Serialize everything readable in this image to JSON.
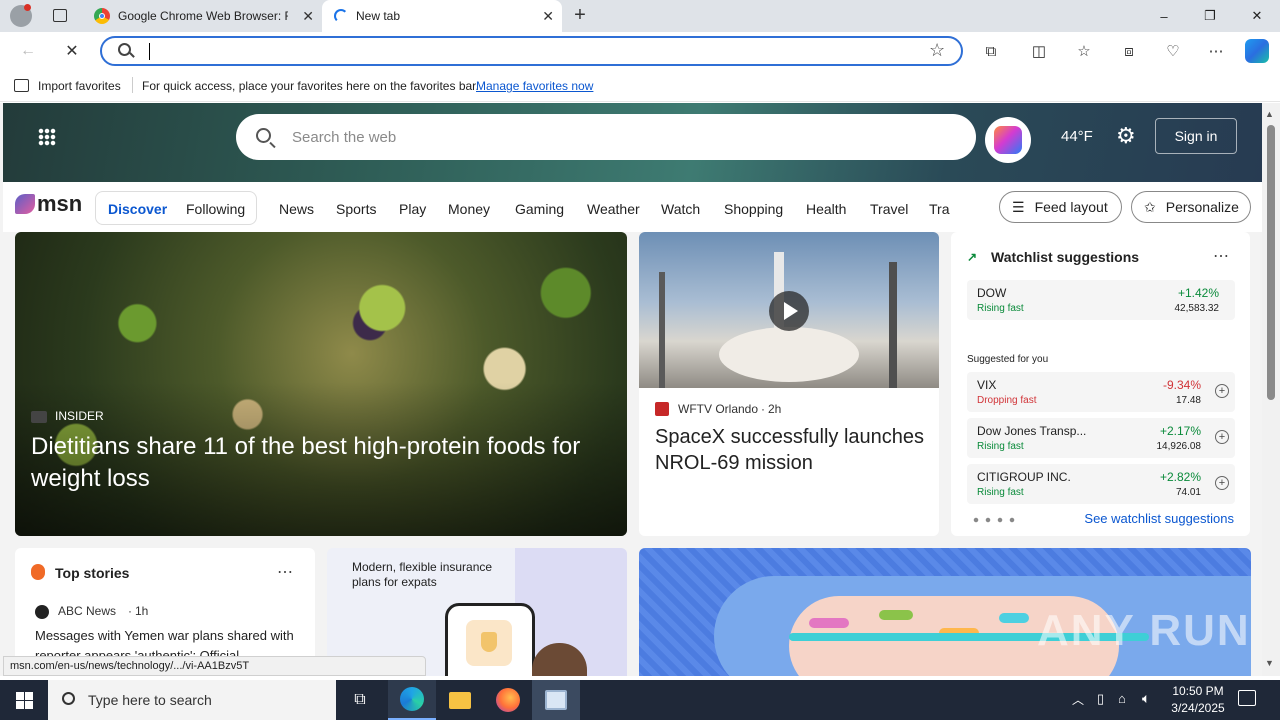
{
  "tabs": [
    {
      "title": "Google Chrome Web Browser: Fi",
      "active": false
    },
    {
      "title": "New tab",
      "active": true
    }
  ],
  "window": {
    "minimize": "–",
    "restore": "❐",
    "close": "✕"
  },
  "favorites_bar": {
    "import_label": "Import favorites",
    "hint_text": "For quick access, place your favorites here on the favorites bar.",
    "manage_link": "Manage favorites now"
  },
  "msn": {
    "search_placeholder": "Search the web",
    "temperature": "44°F",
    "sign_in": "Sign in",
    "logo": "msn",
    "tabs": [
      "Discover",
      "Following"
    ],
    "nav": [
      "News",
      "Sports",
      "Play",
      "Money",
      "Gaming",
      "Weather",
      "Watch",
      "Shopping",
      "Health",
      "Travel",
      "Tra"
    ],
    "feed_layout": "Feed layout",
    "personalize": "Personalize"
  },
  "hero_story": {
    "source": "INSIDER",
    "headline": "Dietitians share 11 of the best high-protein foods for weight loss"
  },
  "video_story": {
    "source": "WFTV Orlando",
    "age": "2h",
    "headline": "SpaceX successfully launches NROL-69 mission"
  },
  "watchlist": {
    "title": "Watchlist suggestions",
    "suggested_label": "Suggested for you",
    "see_more": "See watchlist suggestions",
    "items": [
      {
        "name": "DOW",
        "status": "Rising fast",
        "change": "+1.42%",
        "value": "42,583.32",
        "direction": "up"
      },
      {
        "name": "VIX",
        "status": "Dropping fast",
        "change": "-9.34%",
        "value": "17.48",
        "direction": "down"
      },
      {
        "name": "Dow Jones Transp...",
        "status": "Rising fast",
        "change": "+2.17%",
        "value": "14,926.08",
        "direction": "up"
      },
      {
        "name": "CITIGROUP INC.",
        "status": "Rising fast",
        "change": "+2.82%",
        "value": "74.01",
        "direction": "up"
      }
    ],
    "colors": {
      "up": "#0a8a3a",
      "down": "#d13438"
    }
  },
  "top_stories": {
    "title": "Top stories",
    "source": "ABC News",
    "age": "1h",
    "headline": "Messages with Yemen war plans shared with reporter appears 'authentic': Official"
  },
  "ad_card": {
    "text": "Modern, flexible insurance plans for expats"
  },
  "status_url": "msn.com/en-us/news/technology/.../vi-AA1Bzv5T",
  "watermark": "ANY RUN",
  "taskbar": {
    "search_placeholder": "Type here to search",
    "time": "10:50 PM",
    "date": "3/24/2025"
  }
}
